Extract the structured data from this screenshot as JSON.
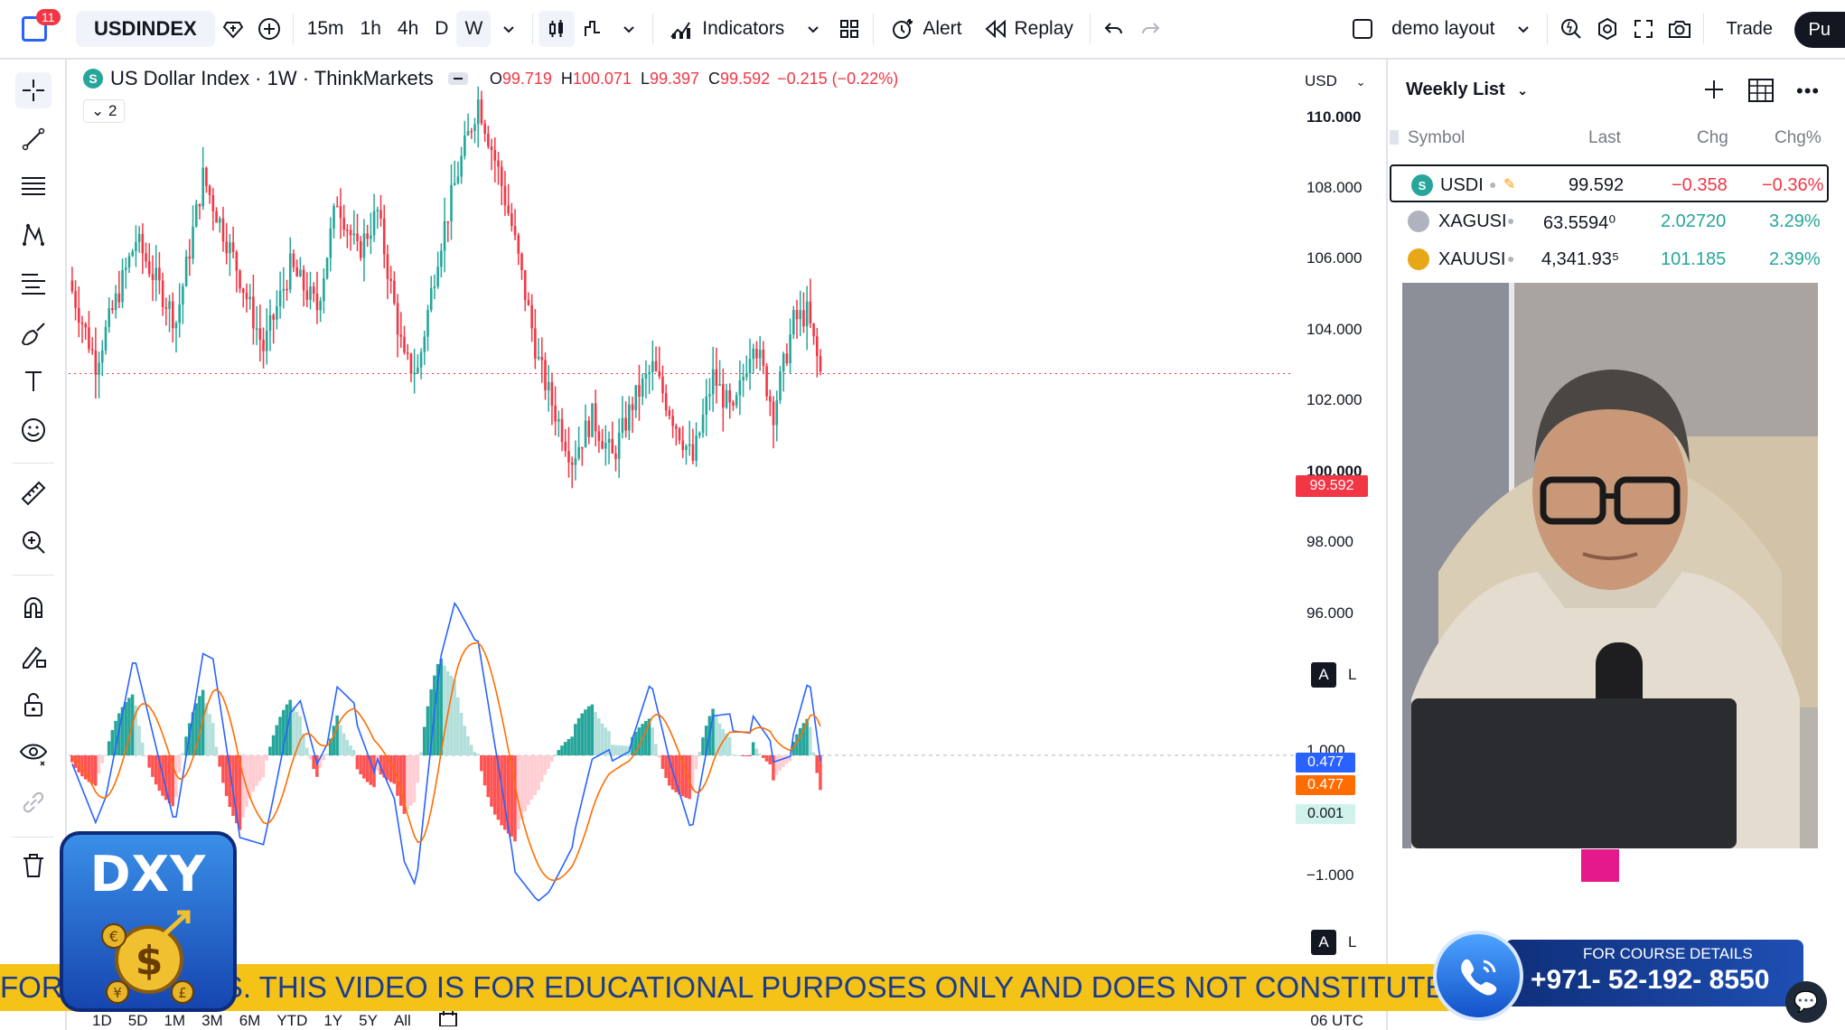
{
  "topbar": {
    "notif_count": "11",
    "symbol": "USDINDEX",
    "intervals": [
      "15m",
      "1h",
      "4h",
      "D",
      "W"
    ],
    "active_interval": "W",
    "indicators_label": "Indicators",
    "alert_label": "Alert",
    "replay_label": "Replay",
    "layout_label": "demo layout",
    "trade_label": "Trade",
    "publish_label": "Pu"
  },
  "legend": {
    "symbol_icon": "S",
    "title": "US Dollar Index · 1W · ThinkMarkets",
    "o_label": "O",
    "o_value": "99.719",
    "h_label": "H",
    "h_value": "100.071",
    "l_label": "L",
    "l_value": "99.397",
    "c_label": "C",
    "c_value": "99.592",
    "change": "−0.215 (−0.22%)",
    "collapsed_count": "2"
  },
  "price_scale": {
    "currency": "USD",
    "labels": [
      "110.000",
      "108.000",
      "106.000",
      "104.000",
      "102.000",
      "100.000",
      "98.000",
      "96.000"
    ],
    "current_price": "99.592",
    "macd_labels": [
      "1.000",
      "−1.000"
    ],
    "macd_values": [
      "0.477",
      "0.477",
      "0.001"
    ],
    "auto_label": "A",
    "log_label": "L"
  },
  "watchlist": {
    "title": "Weekly List",
    "columns": [
      "Symbol",
      "Last",
      "Chg",
      "Chg%"
    ],
    "rows": [
      {
        "icon": "S",
        "symbol": "USDI",
        "last": "99.592",
        "chg": "−0.358",
        "chgp": "−0.36%",
        "color": "#f23645",
        "icon_color": "#26a69a"
      },
      {
        "icon": "",
        "symbol": "XAGUSI",
        "last": "63.5594⁰",
        "chg": "2.02720",
        "chgp": "3.29%",
        "color": "#26a69a",
        "icon_color": "#b0b3bd"
      },
      {
        "icon": "",
        "symbol": "XAUUSI",
        "last": "4,341.93⁵",
        "chg": "101.185",
        "chgp": "2.39%",
        "color": "#26a69a",
        "icon_color": "#e6a817"
      }
    ]
  },
  "bottombar": {
    "ranges": [
      "1D",
      "5D",
      "1M",
      "3M",
      "6M",
      "YTD",
      "1Y",
      "5Y",
      "All"
    ],
    "utc_label": "06 UTC"
  },
  "overlay": {
    "ticker_text": "FOR INVESTORS. THIS VIDEO IS FOR EDUCATIONAL PURPOSES ONLY AND DOES NOT CONSTITUTE FI",
    "dxy_label": "DXY",
    "course_label": "FOR COURSE DETAILS",
    "phone_number": "+971- 52-192- 8550"
  },
  "colors": {
    "up": "#26a69a",
    "down": "#f23645",
    "accent": "#2962ff"
  }
}
